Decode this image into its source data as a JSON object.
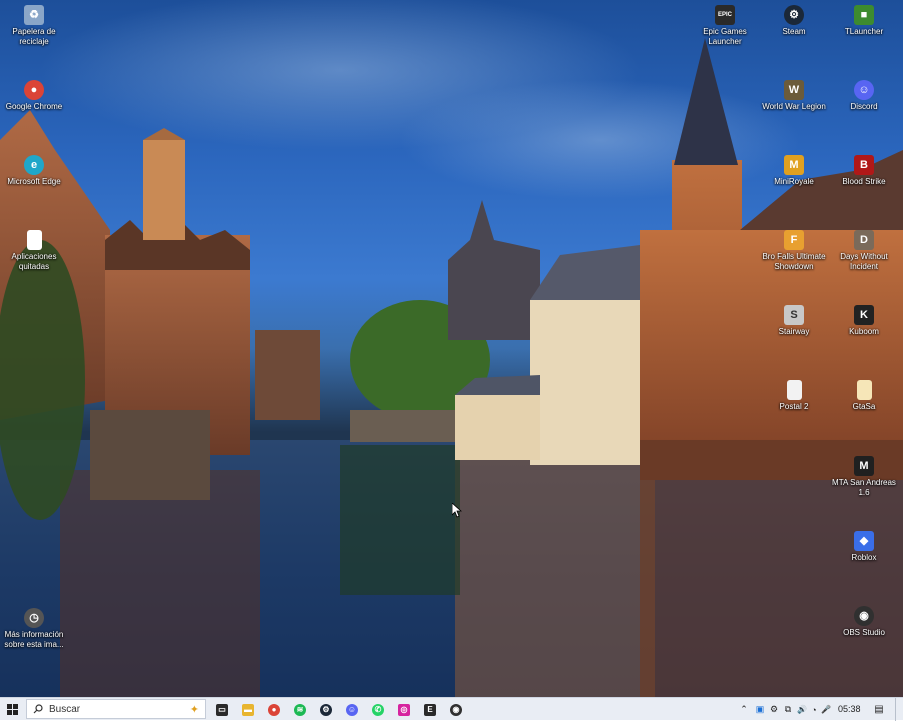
{
  "desktop_icons": [
    {
      "id": "recycle",
      "label": "Papelera de reciclaje",
      "icon": "recycle-bin-icon",
      "color": "#8aa6c8",
      "glyph": "♻"
    },
    {
      "id": "chrome",
      "label": "Google Chrome",
      "icon": "chrome-icon",
      "color": "#db4437",
      "glyph": "●"
    },
    {
      "id": "edge",
      "label": "Microsoft Edge",
      "icon": "edge-icon",
      "color": "#1fa7c9",
      "glyph": "e"
    },
    {
      "id": "apps_removed",
      "label": "Aplicaciones quitadas",
      "icon": "document-icon",
      "color": "#ffffff",
      "glyph": ""
    },
    {
      "id": "more_info",
      "label": "Más información sobre esta ima...",
      "icon": "camera-icon",
      "color": "#555555",
      "glyph": "◷"
    },
    {
      "id": "epic",
      "label": "Epic Games Launcher",
      "icon": "epic-games-icon",
      "color": "#2a2a2a",
      "glyph": "EPIC"
    },
    {
      "id": "steam",
      "label": "Steam",
      "icon": "steam-icon",
      "color": "#1b2838",
      "glyph": "⚙"
    },
    {
      "id": "tlauncher",
      "label": "TLauncher",
      "icon": "tlauncher-icon",
      "color": "#3d8b2f",
      "glyph": "■"
    },
    {
      "id": "wwl",
      "label": "World War Legion",
      "icon": "world-war-legion-icon",
      "color": "#6b5b3a",
      "glyph": "W"
    },
    {
      "id": "discord",
      "label": "Discord",
      "icon": "discord-icon",
      "color": "#5865f2",
      "glyph": "☺"
    },
    {
      "id": "miniroyale",
      "label": "MiniRoyale",
      "icon": "miniroyale-icon",
      "color": "#e0a020",
      "glyph": "M"
    },
    {
      "id": "bloodstrike",
      "label": "Blood Strike",
      "icon": "blood-strike-icon",
      "color": "#b01818",
      "glyph": "B"
    },
    {
      "id": "brofalls",
      "label": "Bro Falls Ultimate Showdown",
      "icon": "bro-falls-icon",
      "color": "#e8a030",
      "glyph": "F"
    },
    {
      "id": "dwi",
      "label": "Days Without Incident",
      "icon": "days-without-incident-icon",
      "color": "#7a6a5a",
      "glyph": "D"
    },
    {
      "id": "stairway",
      "label": "Stairway",
      "icon": "stairway-icon",
      "color": "#c8c8c8",
      "glyph": "S"
    },
    {
      "id": "kuboom",
      "label": "Kuboom",
      "icon": "kuboom-icon",
      "color": "#222222",
      "glyph": "K"
    },
    {
      "id": "postal2",
      "label": "Postal 2",
      "icon": "postal2-icon",
      "color": "#f2f2f2",
      "glyph": ""
    },
    {
      "id": "gta",
      "label": "GtaSa",
      "icon": "gtasa-icon",
      "color": "#f6e6b8",
      "glyph": ""
    },
    {
      "id": "mta",
      "label": "MTA San Andreas 1.6",
      "icon": "mta-icon",
      "color": "#202020",
      "glyph": "M"
    },
    {
      "id": "roblox",
      "label": "Roblox",
      "icon": "roblox-icon",
      "color": "#3a6ee8",
      "glyph": "◆"
    },
    {
      "id": "obs",
      "label": "OBS Studio",
      "icon": "obs-icon",
      "color": "#303030",
      "glyph": "◉"
    }
  ],
  "taskbar": {
    "search_placeholder": "Buscar",
    "pinned": [
      {
        "icon": "task-view-icon",
        "color": "#2a2a2a",
        "glyph": "▭"
      },
      {
        "icon": "file-explorer-icon",
        "color": "#e8b52f",
        "glyph": "▬"
      },
      {
        "icon": "chrome-icon",
        "color": "#db4437",
        "glyph": "●"
      },
      {
        "icon": "spotify-icon",
        "color": "#1db954",
        "glyph": "≋"
      },
      {
        "icon": "steam-icon",
        "color": "#1b2838",
        "glyph": "⚙"
      },
      {
        "icon": "discord-icon",
        "color": "#5865f2",
        "glyph": "☺"
      },
      {
        "icon": "whatsapp-icon",
        "color": "#25d366",
        "glyph": "✆"
      },
      {
        "icon": "instagram-icon",
        "color": "#d6249f",
        "glyph": "◎"
      },
      {
        "icon": "epic-games-icon",
        "color": "#2a2a2a",
        "glyph": "E"
      },
      {
        "icon": "obs-icon",
        "color": "#303030",
        "glyph": "◉"
      }
    ],
    "tray": [
      {
        "icon": "chevron-up-icon",
        "glyph": "⌃"
      },
      {
        "icon": "tray-app-icon",
        "glyph": "▣"
      },
      {
        "icon": "steam-tray-icon",
        "glyph": "⚙"
      },
      {
        "icon": "usb-icon",
        "glyph": "⧉"
      },
      {
        "icon": "volume-icon",
        "glyph": "🔊"
      },
      {
        "icon": "wifi-icon",
        "glyph": "◔"
      },
      {
        "icon": "microphone-icon",
        "glyph": "🎤"
      },
      {
        "icon": "battery-icon",
        "glyph": "▭"
      }
    ],
    "time": "05:38",
    "notifications_glyph": "▤"
  }
}
